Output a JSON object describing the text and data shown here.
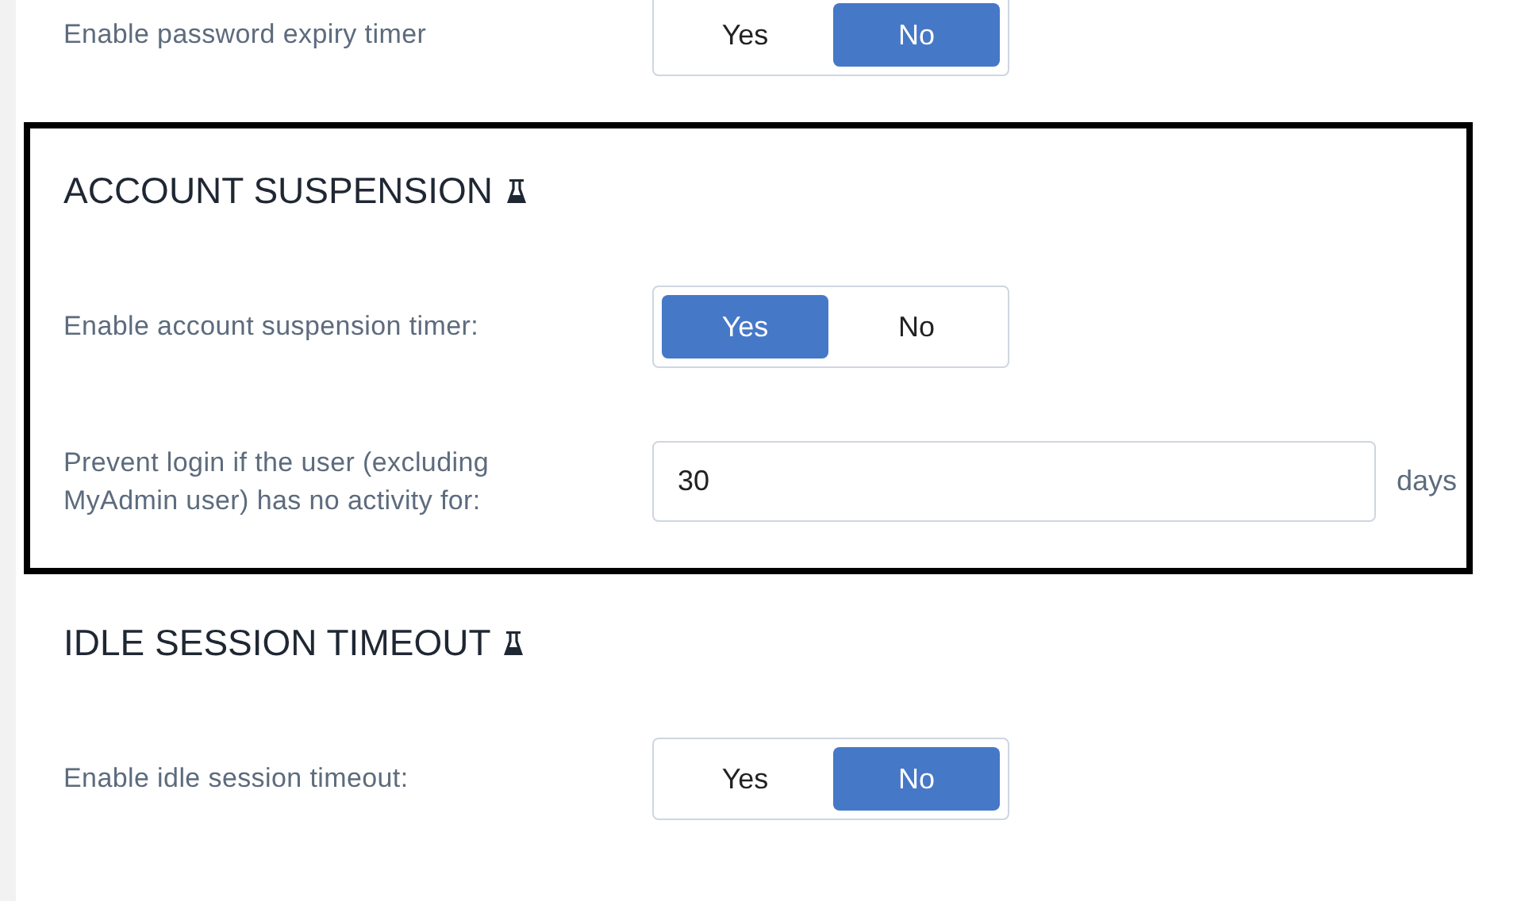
{
  "sections": [
    {
      "highlighted": false,
      "rows": [
        {
          "kind": "toggle",
          "label": "Enable password expiry timer",
          "options": [
            {
              "label": "Yes",
              "selected": false
            },
            {
              "label": "No",
              "selected": true
            }
          ]
        }
      ]
    },
    {
      "title": "ACCOUNT SUSPENSION",
      "highlighted": true,
      "rows": [
        {
          "kind": "toggle",
          "label": "Enable account suspension timer:",
          "options": [
            {
              "label": "Yes",
              "selected": true
            },
            {
              "label": "No",
              "selected": false
            }
          ]
        },
        {
          "kind": "number",
          "label": "Prevent login if the user (excluding MyAdmin user) has no activity for:",
          "value": "30",
          "unit": "days"
        }
      ]
    },
    {
      "title": "IDLE SESSION TIMEOUT",
      "highlighted": false,
      "rows": [
        {
          "kind": "toggle",
          "label": "Enable idle session timeout:",
          "options": [
            {
              "label": "Yes",
              "selected": false
            },
            {
              "label": "No",
              "selected": true
            }
          ]
        }
      ]
    }
  ]
}
